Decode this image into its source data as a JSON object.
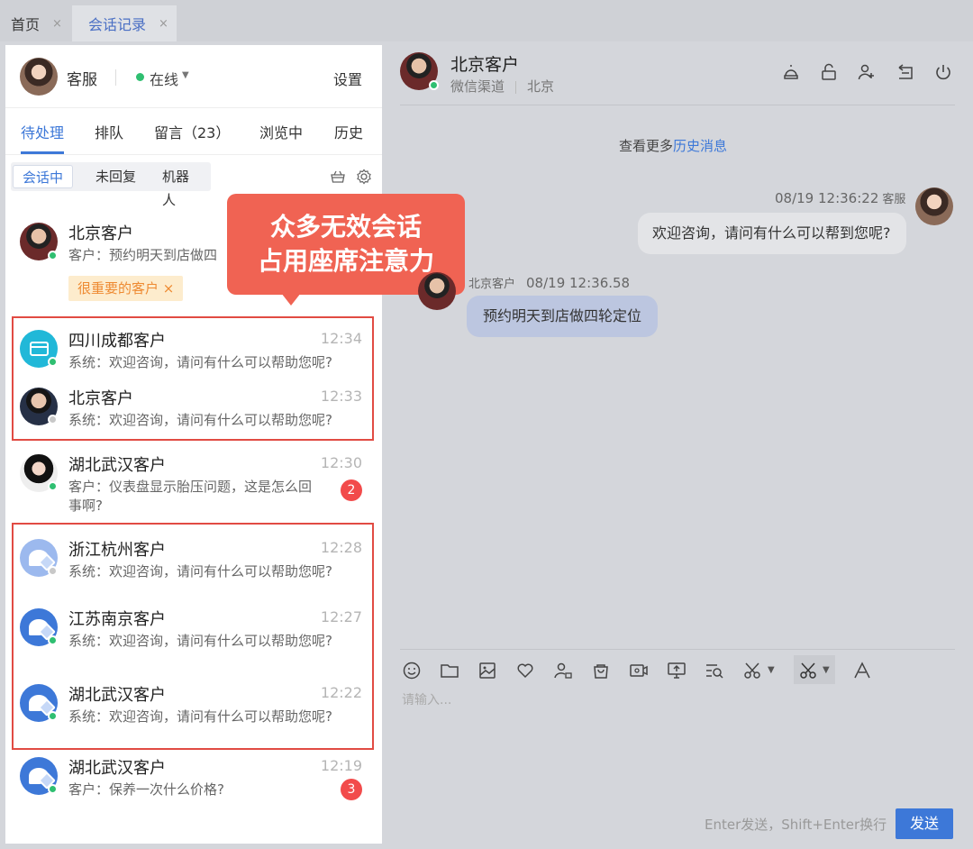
{
  "top_tabs": [
    {
      "label": "首页",
      "close": "×"
    },
    {
      "label": "会话记录",
      "close": "×"
    }
  ],
  "agent": {
    "name": "客服",
    "status": "在线",
    "settings": "设置"
  },
  "main_tabs": [
    "待处理",
    "排队",
    "留言（23）",
    "浏览中",
    "历史"
  ],
  "sub_tabs": [
    "会话中",
    "未回复",
    "机器人"
  ],
  "sessions": [
    {
      "name": "北京客户",
      "time": "",
      "msg": "客户：预约明天到店做四",
      "tag": "很重要的客户",
      "tag_close": "×"
    },
    {
      "name": "四川成都客户",
      "time": "12:34",
      "msg": "系统：欢迎咨询，请问有什么可以帮助您呢?"
    },
    {
      "name": "北京客户",
      "time": "12:33",
      "msg": "系统：欢迎咨询，请问有什么可以帮助您呢?"
    },
    {
      "name": "湖北武汉客户",
      "time": "12:30",
      "msg": "客户：仪表盘显示胎压问题，这是怎么回事啊?",
      "badge": "2"
    },
    {
      "name": "浙江杭州客户",
      "time": "12:28",
      "msg": "系统：欢迎咨询，请问有什么可以帮助您呢?"
    },
    {
      "name": "江苏南京客户",
      "time": "12:27",
      "msg": "系统：欢迎咨询，请问有什么可以帮助您呢?"
    },
    {
      "name": "湖北武汉客户",
      "time": "12:22",
      "msg": "系统：欢迎咨询，请问有什么可以帮助您呢?"
    },
    {
      "name": "湖北武汉客户",
      "time": "12:19",
      "msg": "客户：保养一次什么价格?",
      "badge": "3"
    }
  ],
  "callout": {
    "line1": "众多无效会话",
    "line2": "占用座席注意力"
  },
  "chat": {
    "title": "北京客户",
    "channel": "微信渠道",
    "city": "北京",
    "load_more_prefix": "查看更多",
    "load_more_link": "历史消息",
    "messages": [
      {
        "time": "08/19 12:36:22",
        "sender": "客服",
        "text": "欢迎咨询，请问有什么可以帮到您呢?"
      },
      {
        "time": "08/19 12:36.58",
        "sender": "北京客户",
        "text": "预约明天到店做四轮定位"
      }
    ],
    "input_placeholder": "请输入...",
    "hint": "Enter发送，Shift+Enter换行",
    "send": "发送"
  },
  "colors": {
    "accent": "#3d78d8",
    "online": "#2fbf71",
    "badge": "#f24b4b",
    "highlight_box": "#e14b43",
    "callout": "#f06353"
  }
}
